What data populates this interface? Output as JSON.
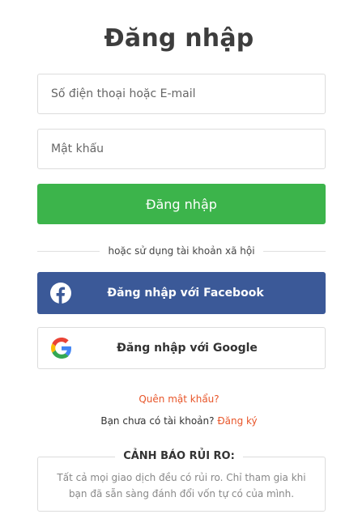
{
  "page": {
    "title": "Đăng nhập"
  },
  "form": {
    "username_placeholder": "Số điện thoại hoặc E-mail",
    "username_value": "",
    "password_placeholder": "Mật khẩu",
    "password_value": "",
    "login_button": "Đăng nhập"
  },
  "social": {
    "divider_text": "hoặc sử dụng tài khoản xã hội",
    "facebook_label": "Đăng nhập với Facebook",
    "facebook_icon": "facebook-icon",
    "google_label": "Đăng nhập với Google",
    "google_icon": "google-icon"
  },
  "links": {
    "forgot_password": "Quên mật khẩu?",
    "no_account_text": "Bạn chưa có tài khoản?",
    "signup": "Đăng ký"
  },
  "risk": {
    "title": "CẢNH BÁO RỦI RO:",
    "text": "Tất cả mọi giao dịch đều có rủi ro. Chỉ tham gia khi bạn đã sẵn sàng đánh đổi vốn tự có của mình."
  },
  "colors": {
    "primary_green": "#3cb44b",
    "facebook_blue": "#3b5998",
    "link_orange": "#e8562a"
  }
}
